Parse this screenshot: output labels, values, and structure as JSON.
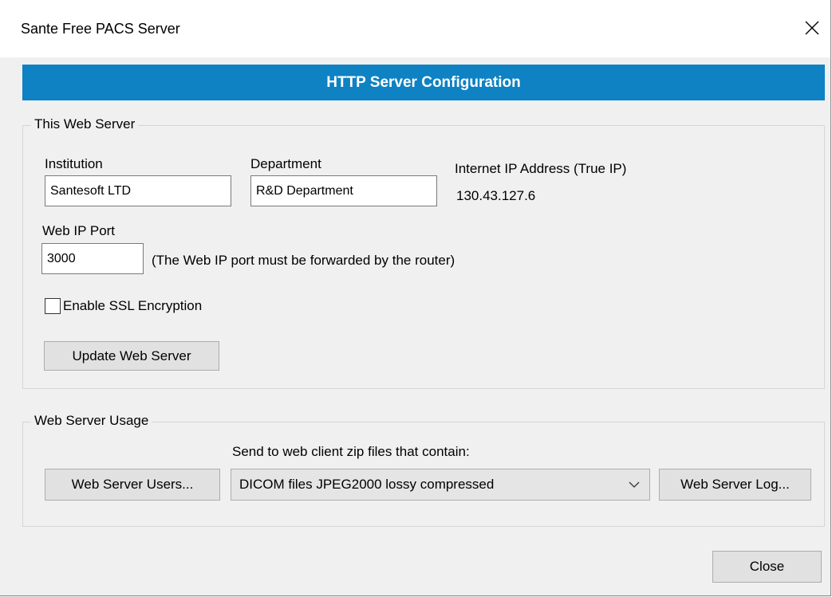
{
  "window": {
    "title": "Sante Free PACS Server",
    "close_icon": "close-icon"
  },
  "header": {
    "title": "HTTP Server Configuration",
    "band_color": "#0e82c2"
  },
  "this_web_server": {
    "legend": "This Web Server",
    "institution_label": "Institution",
    "institution_value": "Santesoft LTD",
    "department_label": "Department",
    "department_value": "R&D Department",
    "internet_ip_label": "Internet IP Address (True IP)",
    "internet_ip_value": "130.43.127.6",
    "web_ip_port_label": "Web IP Port",
    "web_ip_port_value": "3000",
    "port_note": "(The Web IP port must be forwarded by the router)",
    "ssl_label": "Enable SSL Encryption",
    "ssl_checked": false,
    "update_button": "Update Web Server"
  },
  "web_server_usage": {
    "legend": "Web Server Usage",
    "zip_label": "Send to web client zip files that contain:",
    "users_button": "Web Server Users...",
    "zip_selected": "DICOM files JPEG2000 lossy compressed",
    "log_button": "Web Server Log..."
  },
  "footer": {
    "close_button": "Close"
  }
}
